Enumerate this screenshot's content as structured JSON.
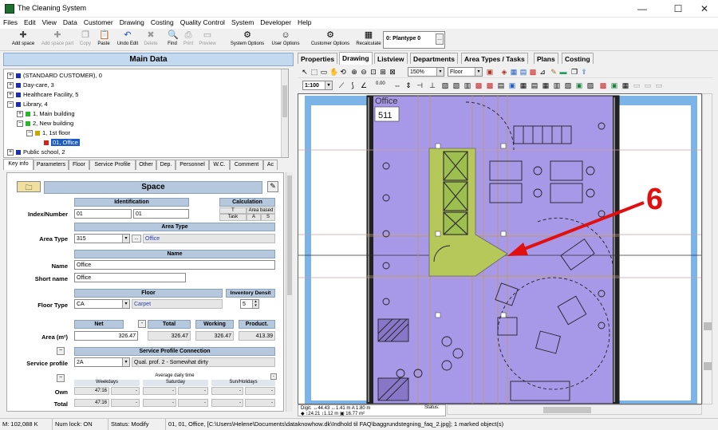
{
  "window": {
    "title": "The Cleaning System",
    "minimize": "—",
    "maximize": "☐",
    "close": "✕"
  },
  "menu": [
    "Files",
    "Edit",
    "View",
    "Data",
    "Customer",
    "Drawing",
    "Costing",
    "Quality Control",
    "System",
    "Developer",
    "Help"
  ],
  "toolbar": {
    "add_space": "Add space",
    "add_space_part": "Add space part",
    "copy": "Copy",
    "paste": "Paste",
    "undo_edit": "Undo Edit",
    "delete": "Delete",
    "find": "Find",
    "print": "Print",
    "preview": "Preview",
    "system_options": "System Options",
    "user_options": "User Options",
    "customer_options": "Customer Options",
    "recalculate": "Recalculate",
    "plantype": "0: Plantype 0",
    "plantype_btn": "..."
  },
  "main_data": {
    "title": "Main Data"
  },
  "tree": [
    {
      "toggle": "+",
      "label": "(STANDARD CUSTOMER), 0",
      "color": "#1e2ea8"
    },
    {
      "toggle": "+",
      "label": "Day-care, 3",
      "color": "#1e2ea8"
    },
    {
      "toggle": "+",
      "label": "Healthcare Facility, 5",
      "color": "#1e2ea8"
    },
    {
      "toggle": "−",
      "label": "Library, 4",
      "color": "#1e2ea8"
    },
    {
      "toggle": "+",
      "label": "1, Main building",
      "color": "#2cb52c"
    },
    {
      "toggle": "−",
      "label": "2, New building",
      "color": "#2cb52c"
    },
    {
      "toggle": "−",
      "label": "1, 1st floor",
      "color": "#c8a800"
    },
    {
      "toggle": "",
      "label": "01, Office",
      "color": "#d62020"
    },
    {
      "toggle": "+",
      "label": "Public school, 2",
      "color": "#1e2ea8"
    }
  ],
  "left_tabs": [
    "Key info",
    "Parameters",
    "Floor",
    "Service Profile",
    "Other",
    "Dep.",
    "Personnel",
    "W.C.",
    "Comment",
    "Ac"
  ],
  "form": {
    "section_title": "Space",
    "identification_hdr": "Identification",
    "calculation_hdr": "Calculation",
    "calc_t": "T",
    "calc_area_based": "Area based",
    "calc_task": "Task",
    "calc_a": "A",
    "calc_s": "S",
    "index_label": "Index/Number",
    "index_value": "01",
    "number_value": "01",
    "area_type_hdr": "Area Type",
    "area_type_label": "Area Type",
    "area_type_code": "315",
    "area_type_name": "Office",
    "name_hdr": "Name",
    "name_label": "Name",
    "name_value": "Office",
    "short_name_label": "Short name",
    "short_name_value": "Office",
    "floor_hdr": "Floor",
    "inventory_hdr": "Inventory Densit",
    "floor_type_label": "Floor Type",
    "floor_type_code": "CA",
    "floor_type_name": "Carpet",
    "inventory_value": "5",
    "net_hdr": "Net",
    "total_hdr": "Total",
    "working_hdr": "Working",
    "product_hdr": "Product.",
    "area_label": "Area (m²)",
    "net_value": "326.47",
    "total_value": "326.47",
    "working_value": "326.47",
    "product_value": "413.39",
    "service_conn_hdr": "Service Profile Connection",
    "service_profile_label": "Service profile",
    "service_profile_code": "2A",
    "service_profile_name": "Qual. prof. 2 - Somewhat dirty",
    "avg_daily_time": "Average daily time",
    "weekdays": "Weekdays",
    "saturday": "Saturday",
    "sun_holidays": "Sun/Holidays",
    "own_label": "Own",
    "total_label": "Total",
    "own_weekdays": "47:16",
    "own_sat": "-",
    "own_sat2": "-",
    "own_sun": "-",
    "own_sun2": "-",
    "total_weekdays": "47:16",
    "total_sat": "-",
    "total_sat2": "-",
    "total_sun": "-",
    "total_sun2": "-",
    "dash": "-",
    "minus": "−",
    "dropdown": "▾"
  },
  "right_tabs": [
    "Properties",
    "Drawing",
    "Listview",
    "Departments",
    "Area Types / Tasks",
    "Plans",
    "Costing"
  ],
  "drawing_toolbar": {
    "zoom": "150%",
    "layer": "Floor",
    "scale": "1:100",
    "value": "0.00"
  },
  "drawing": {
    "room_label": "Office",
    "room_number": "511",
    "annotation_number": "6",
    "colors": {
      "room_fill": "#a899e8",
      "highlight": "#b6c85a",
      "frame": "#7cb4e8",
      "annotation": "#e01010"
    }
  },
  "coords": {
    "line1": "Digit. ↔44.43   ↔1.41 m   A 1.80 m",
    "line2": "  ◆   ↕24.21   ↕1.12 m   ▣ 16.77 m²",
    "status": "Status:"
  },
  "statusbar": {
    "memory": "M: 102,088 K",
    "numlock": "Num lock: ON",
    "status": "Status: Modify",
    "info": "01, 01, Office, [C:\\Users\\Helene\\Documents\\dataknowhow.dk\\Indhold til FAQ\\baggrundstegning_faq_2.jpg]; 1 marked object(s)"
  }
}
